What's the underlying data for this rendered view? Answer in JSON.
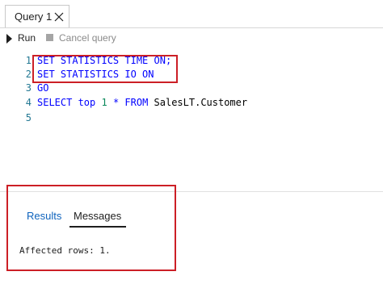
{
  "tab": {
    "title": "Query 1"
  },
  "toolbar": {
    "run_label": "Run",
    "cancel_label": "Cancel query"
  },
  "editor": {
    "lines": [
      {
        "number": "1",
        "tokens": [
          {
            "text": "SET STATISTICS TIME ON;",
            "kind": "keyword"
          }
        ]
      },
      {
        "number": "2",
        "tokens": [
          {
            "text": "SET STATISTICS IO ON",
            "kind": "keyword"
          }
        ]
      },
      {
        "number": "3",
        "tokens": [
          {
            "text": "GO",
            "kind": "keyword"
          }
        ]
      },
      {
        "number": "4",
        "tokens": [
          {
            "text": "SELECT top ",
            "kind": "keyword"
          },
          {
            "text": "1",
            "kind": "number"
          },
          {
            "text": " * FROM ",
            "kind": "keyword"
          },
          {
            "text": "SalesLT.Customer",
            "kind": "identifier"
          }
        ]
      },
      {
        "number": "5",
        "tokens": []
      }
    ]
  },
  "results_panel": {
    "tabs": [
      {
        "label": "Results"
      },
      {
        "label": "Messages"
      }
    ],
    "active_tab": "Messages",
    "message": "Affected rows: 1."
  },
  "colors": {
    "keyword": "#0000ff",
    "number": "#09885a",
    "line_number": "#237893",
    "highlight_box": "#cc1f26",
    "results_tab": "#0e63bd"
  },
  "icons": {
    "tab_close": "close-icon",
    "run": "play-icon",
    "cancel": "stop-icon"
  }
}
